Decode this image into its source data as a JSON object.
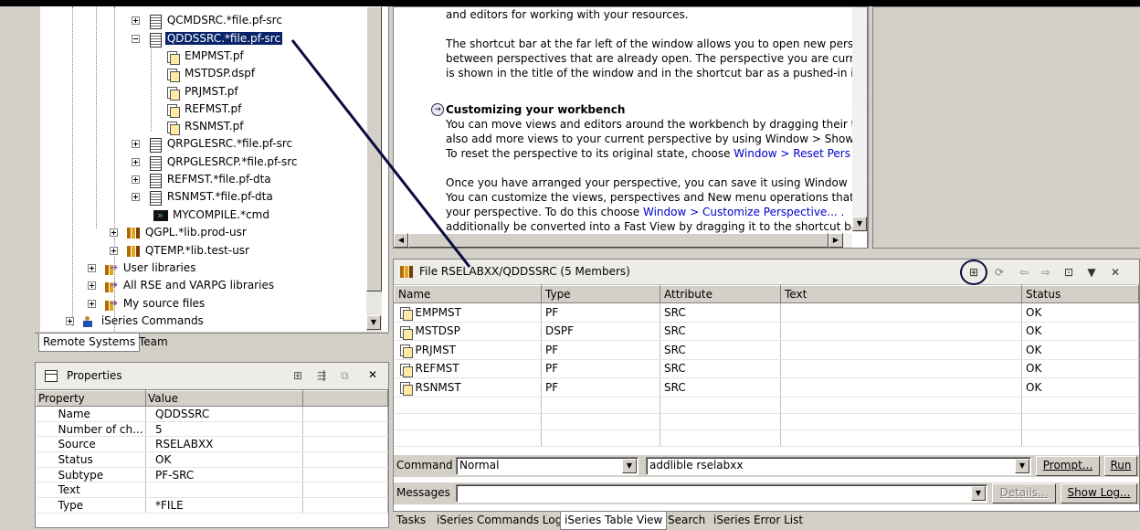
{
  "tree": {
    "items": [
      {
        "label": "QCMDSRC.*file.pf-src",
        "icon": "source-file-icon"
      },
      {
        "label": "QDDSSRC.*file.pf-src",
        "icon": "source-file-icon"
      },
      {
        "label": "EMPMST.pf",
        "icon": "member-icon"
      },
      {
        "label": "MSTDSP.dspf",
        "icon": "member-icon"
      },
      {
        "label": "PRJMST.pf",
        "icon": "member-icon"
      },
      {
        "label": "REFMST.pf",
        "icon": "member-icon"
      },
      {
        "label": "RSNMST.pf",
        "icon": "member-icon"
      },
      {
        "label": "QRPGLESRC.*file.pf-src",
        "icon": "source-file-icon"
      },
      {
        "label": "QRPGLESRCP.*file.pf-src",
        "icon": "source-file-icon"
      },
      {
        "label": "REFMST.*file.pf-dta",
        "icon": "data-file-icon"
      },
      {
        "label": "RSNMST.*file.pf-dta",
        "icon": "data-file-icon"
      },
      {
        "label": "MYCOMPILE.*cmd",
        "icon": "command-icon"
      },
      {
        "label": "QGPL.*lib.prod-usr",
        "icon": "library-icon"
      },
      {
        "label": "QTEMP.*lib.test-usr",
        "icon": "library-icon"
      },
      {
        "label": "User libraries",
        "icon": "user-libraries-icon"
      },
      {
        "label": "All RSE and VARPG libraries",
        "icon": "all-libraries-icon"
      },
      {
        "label": "My source files",
        "icon": "source-files-filter-icon"
      },
      {
        "label": "iSeries Commands",
        "icon": "commands-icon"
      }
    ]
  },
  "left_tabs": [
    "Remote Systems",
    "Team"
  ],
  "properties": {
    "title": "Properties",
    "columns": [
      "Property",
      "Value"
    ],
    "rows": [
      {
        "property": "Name",
        "value": "QDDSSRC"
      },
      {
        "property": "Number of ch...",
        "value": "5"
      },
      {
        "property": "Source",
        "value": "RSELABXX"
      },
      {
        "property": "Status",
        "value": "OK"
      },
      {
        "property": "Subtype",
        "value": "PF-SRC"
      },
      {
        "property": "Text",
        "value": ""
      },
      {
        "property": "Type",
        "value": "*FILE"
      }
    ]
  },
  "welcome": {
    "line1": "and editors for working with your resources.",
    "p2": [
      "The shortcut bar at the far left of the window allows you to open new pers",
      "between perspectives that are already open. The perspective you are curr",
      "is shown in the title of the window and in the shortcut bar as a pushed-in ic"
    ],
    "heading": "Customizing your workbench",
    "p3a": "You can move views and editors around the workbench by dragging their ti",
    "p3b": "also add more views to your current perspective by using Window > Show",
    "p3c_pre": "To reset the perspective to its original state, choose ",
    "p3c_link": "Window > Reset Pers",
    "p4a": "Once you have arranged your perspective, you can save it using Window :",
    "p4b": "You can customize the views, perspectives and New menu operations that",
    "p4c_pre": "your perspective. To do this choose ",
    "p4c_link": "Window > Customize Perspective... .",
    "p4d": "additionally be converted into a Fast View by dragging it to the shortcut ba"
  },
  "table_view": {
    "title": "File RSELABXX/QDDSSRC (5 Members)",
    "columns": [
      "Name",
      "Type",
      "Attribute",
      "Text",
      "Status"
    ],
    "rows": [
      {
        "name": "EMPMST",
        "type": "PF",
        "attribute": "SRC",
        "text": "",
        "status": "OK"
      },
      {
        "name": "MSTDSP",
        "type": "DSPF",
        "attribute": "SRC",
        "text": "",
        "status": "OK"
      },
      {
        "name": "PRJMST",
        "type": "PF",
        "attribute": "SRC",
        "text": "",
        "status": "OK"
      },
      {
        "name": "REFMST",
        "type": "PF",
        "attribute": "SRC",
        "text": "",
        "status": "OK"
      },
      {
        "name": "RSNMST",
        "type": "PF",
        "attribute": "SRC",
        "text": "",
        "status": "OK"
      }
    ]
  },
  "command": {
    "label": "Command",
    "mode": "Normal",
    "value": "addlible rselabxx",
    "prompt_label": "Prompt...",
    "run_label": "Run",
    "messages_label": "Messages",
    "details_label": "Details...",
    "showlog_label": "Show Log..."
  },
  "bottom_tabs": [
    "Tasks",
    "iSeries Commands Log",
    "iSeries Table View",
    "Search",
    "iSeries Error List"
  ],
  "colors": {
    "selection": "#0a246a",
    "link": "#0000c8",
    "annotation": "#0a0a40"
  }
}
